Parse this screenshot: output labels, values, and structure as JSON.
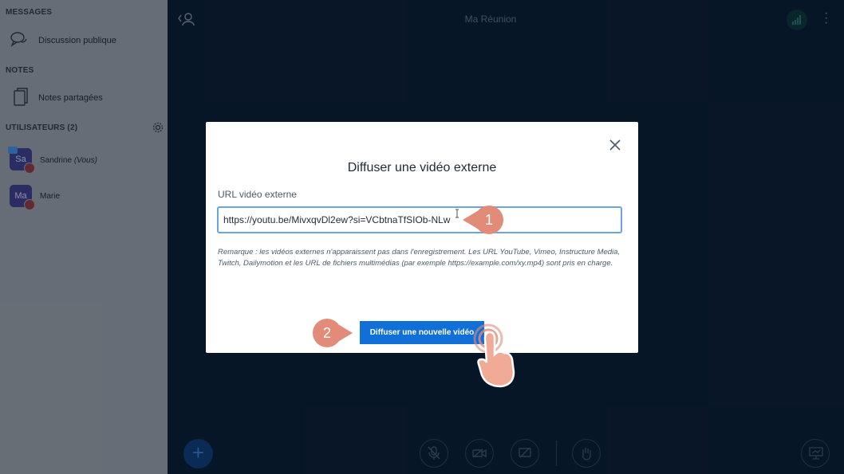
{
  "sidebar": {
    "messages_title": "MESSAGES",
    "public_chat_label": "Discussion publique",
    "notes_title": "NOTES",
    "shared_notes_label": "Notes partagées",
    "users_title": "UTILISATEURS (2)",
    "users": [
      {
        "initials": "Sa",
        "name": "Sandrine",
        "suffix": "(Vous)"
      },
      {
        "initials": "Ma",
        "name": "Marie",
        "suffix": ""
      }
    ]
  },
  "header": {
    "meeting_title": "Ma Réunion"
  },
  "modal": {
    "title": "Diffuser une vidéo externe",
    "field_label": "URL vidéo externe",
    "url_value": "https://youtu.be/MivxqvDl2ew?si=VCbtnaTfSIOb-NLw",
    "note": "Remarque : les vidéos externes n'apparaissent pas dans l'enregistrement. Les URL YouTube, Vimeo, Instructure Media, Twitch, Dailymotion et les URL de fichiers multimédias (par exemple https://example.com/xy.mp4) sont pris en charge.",
    "submit_label": "Diffuser une nouvelle vidéo"
  },
  "callouts": {
    "step1": "1",
    "step2": "2"
  },
  "colors": {
    "accent": "#1070d8",
    "callout": "#e28b78",
    "sidebar": "#8e98a4",
    "background": "#0b1f36"
  }
}
